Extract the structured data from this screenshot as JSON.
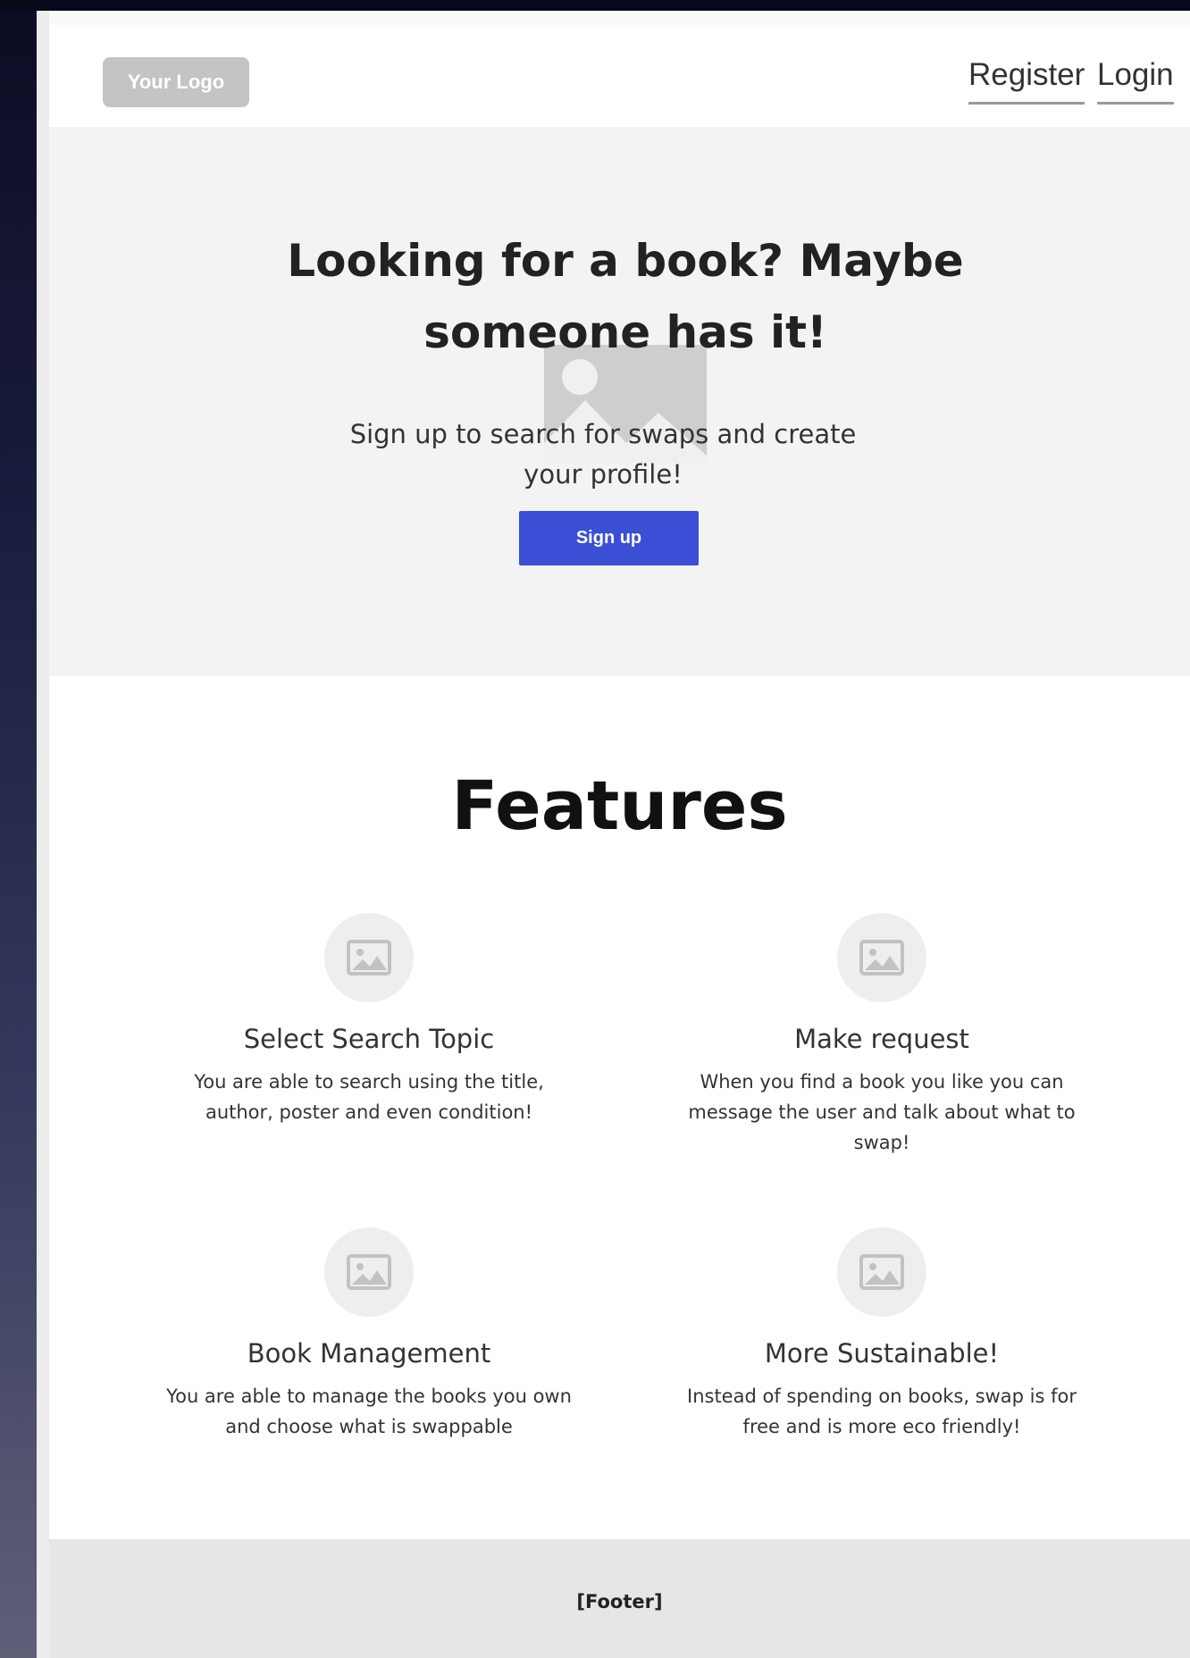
{
  "header": {
    "logo_text": "Your Logo",
    "nav": {
      "register_label": "Register",
      "login_label": "Login"
    }
  },
  "hero": {
    "title": "Looking for a book? Maybe someone has it!",
    "subtitle": "Sign up to search for swaps and create your profile!",
    "cta_label": "Sign up",
    "image_icon": "image-placeholder-icon"
  },
  "features": {
    "title": "Features",
    "items": [
      {
        "icon": "image-icon",
        "title": "Select Search Topic",
        "description": "You are able to search using the title, author, poster and even condition!"
      },
      {
        "icon": "image-icon",
        "title": "Make request",
        "description": "When you find a book you like you can message the user and talk about what to swap!"
      },
      {
        "icon": "image-icon",
        "title": "Book Management",
        "description": "You are able to manage the books you own and choose what is swappable"
      },
      {
        "icon": "image-icon",
        "title": "More Sustainable!",
        "description": "Instead of spending on books, swap is for free and is more eco friendly!"
      }
    ]
  },
  "footer": {
    "text": "[Footer]"
  },
  "colors": {
    "primary_button": "#3b4fd6",
    "hero_background": "#f3f3f3",
    "footer_background": "#e6e6e6",
    "logo_background": "#c4c4c4"
  }
}
